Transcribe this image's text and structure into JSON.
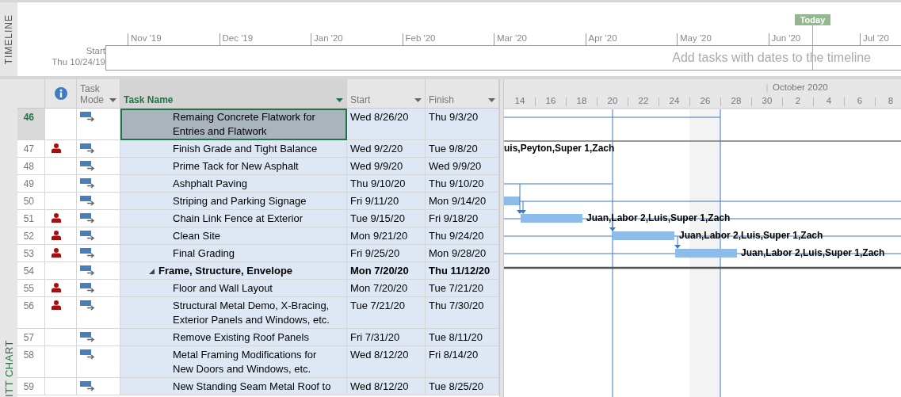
{
  "timeline": {
    "label": "TIMELINE",
    "start_label": "Start",
    "start_date": "Thu 10/24/19",
    "placeholder": "Add tasks with dates to the timeline",
    "today": "Today",
    "months": [
      "Nov '19",
      "Dec '19",
      "Jan '20",
      "Feb '20",
      "Mar '20",
      "Apr '20",
      "May '20",
      "Jun '20",
      "Jul '20"
    ]
  },
  "side_label": "ITT CHART",
  "table": {
    "columns": [
      {
        "kind": "info"
      },
      {
        "kind": "text",
        "label": "Task Mode",
        "selected": false
      },
      {
        "kind": "text",
        "label": "Task Name",
        "selected": true
      },
      {
        "kind": "text",
        "label": "Start",
        "selected": false
      },
      {
        "kind": "text",
        "label": "Finish",
        "selected": false
      }
    ],
    "rows": [
      {
        "id": "46",
        "assigned": false,
        "name": "Remaing Concrete Flatwork for Entries and Flatwork",
        "start": "Wed 8/26/20",
        "finish": "Thu 9/3/20",
        "summary": false,
        "selected": true
      },
      {
        "id": "47",
        "assigned": true,
        "name": "Finish Grade and Tight Balance",
        "start": "Wed 9/2/20",
        "finish": "Tue 9/8/20",
        "summary": false,
        "selected": false
      },
      {
        "id": "48",
        "assigned": false,
        "name": "Prime Tack for New Asphalt",
        "start": "Wed 9/9/20",
        "finish": "Wed 9/9/20",
        "summary": false,
        "selected": false
      },
      {
        "id": "49",
        "assigned": false,
        "name": "Ashphalt Paving",
        "start": "Thu 9/10/20",
        "finish": "Thu 9/10/20",
        "summary": false,
        "selected": false
      },
      {
        "id": "50",
        "assigned": false,
        "name": "Striping and Parking Signage",
        "start": "Fri 9/11/20",
        "finish": "Mon 9/14/20",
        "summary": false,
        "selected": false
      },
      {
        "id": "51",
        "assigned": true,
        "name": "Chain Link Fence at Exterior",
        "start": "Tue 9/15/20",
        "finish": "Fri 9/18/20",
        "summary": false,
        "selected": false
      },
      {
        "id": "52",
        "assigned": true,
        "name": "Clean Site",
        "start": "Mon 9/21/20",
        "finish": "Thu 9/24/20",
        "summary": false,
        "selected": false
      },
      {
        "id": "53",
        "assigned": true,
        "name": "Final Grading",
        "start": "Fri 9/25/20",
        "finish": "Mon 9/28/20",
        "summary": false,
        "selected": false
      },
      {
        "id": "54",
        "assigned": false,
        "name": "Frame, Structure, Envelope",
        "start": "Mon 7/20/20",
        "finish": "Thu 11/12/20",
        "summary": true,
        "expanded": true,
        "selected": false
      },
      {
        "id": "55",
        "assigned": true,
        "name": "Floor and Wall Layout",
        "start": "Mon 7/20/20",
        "finish": "Tue 7/21/20",
        "summary": false,
        "selected": false
      },
      {
        "id": "56",
        "assigned": true,
        "name": "Structural Metal Demo, X-Bracing, Exterior Panels and Windows, etc.",
        "start": "Tue 7/21/20",
        "finish": "Thu 7/30/20",
        "summary": false,
        "selected": false
      },
      {
        "id": "57",
        "assigned": false,
        "name": "Remove Existing Roof Panels",
        "start": "Fri 7/31/20",
        "finish": "Tue 8/11/20",
        "summary": false,
        "selected": false
      },
      {
        "id": "58",
        "assigned": false,
        "name": "Metal Framing Modifications for New Doors and Windows, etc.",
        "start": "Wed 8/12/20",
        "finish": "Fri 8/14/20",
        "summary": false,
        "selected": false
      },
      {
        "id": "59",
        "assigned": false,
        "name": "New Standing Seam Metal Roof to",
        "start": "Wed 8/12/20",
        "finish": "Tue 8/25/20",
        "summary": false,
        "selected": false
      }
    ]
  },
  "gantt": {
    "month": "October 2020",
    "days": [
      "14",
      "16",
      "18",
      "20",
      "22",
      "24",
      "26",
      "28",
      "30",
      "2",
      "4",
      "6",
      "8"
    ],
    "labels": [
      "uis,Peyton,Super 1,Zach",
      "Juan,Labor 2,Luis,Super 1,Zach",
      "Juan,Labor 2,Luis,Super 1,Zach",
      "Juan,Labor 2,Luis,Super 1,Zach"
    ]
  }
}
